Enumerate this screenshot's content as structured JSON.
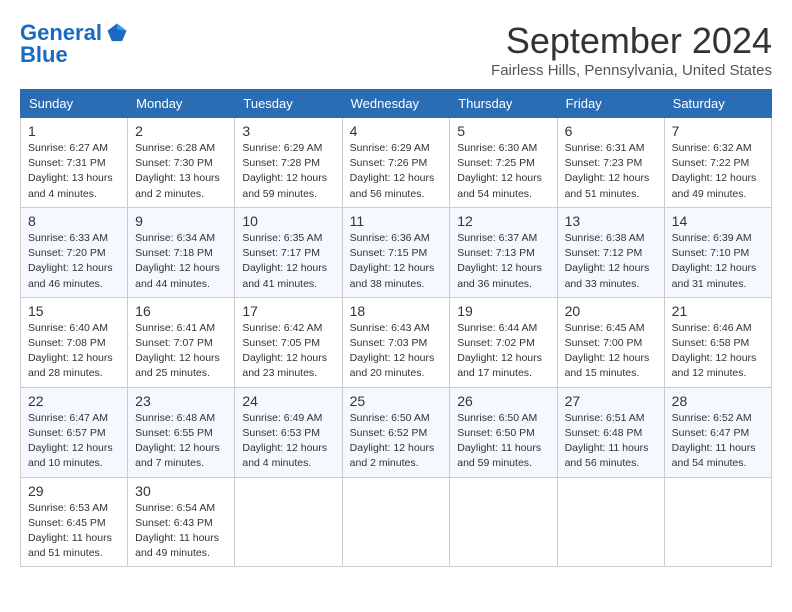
{
  "header": {
    "logo_general": "General",
    "logo_blue": "Blue",
    "month_year": "September 2024",
    "location": "Fairless Hills, Pennsylvania, United States"
  },
  "days_of_week": [
    "Sunday",
    "Monday",
    "Tuesday",
    "Wednesday",
    "Thursday",
    "Friday",
    "Saturday"
  ],
  "weeks": [
    [
      {
        "day": "1",
        "sunrise": "6:27 AM",
        "sunset": "7:31 PM",
        "daylight": "13 hours and 4 minutes."
      },
      {
        "day": "2",
        "sunrise": "6:28 AM",
        "sunset": "7:30 PM",
        "daylight": "13 hours and 2 minutes."
      },
      {
        "day": "3",
        "sunrise": "6:29 AM",
        "sunset": "7:28 PM",
        "daylight": "12 hours and 59 minutes."
      },
      {
        "day": "4",
        "sunrise": "6:29 AM",
        "sunset": "7:26 PM",
        "daylight": "12 hours and 56 minutes."
      },
      {
        "day": "5",
        "sunrise": "6:30 AM",
        "sunset": "7:25 PM",
        "daylight": "12 hours and 54 minutes."
      },
      {
        "day": "6",
        "sunrise": "6:31 AM",
        "sunset": "7:23 PM",
        "daylight": "12 hours and 51 minutes."
      },
      {
        "day": "7",
        "sunrise": "6:32 AM",
        "sunset": "7:22 PM",
        "daylight": "12 hours and 49 minutes."
      }
    ],
    [
      {
        "day": "8",
        "sunrise": "6:33 AM",
        "sunset": "7:20 PM",
        "daylight": "12 hours and 46 minutes."
      },
      {
        "day": "9",
        "sunrise": "6:34 AM",
        "sunset": "7:18 PM",
        "daylight": "12 hours and 44 minutes."
      },
      {
        "day": "10",
        "sunrise": "6:35 AM",
        "sunset": "7:17 PM",
        "daylight": "12 hours and 41 minutes."
      },
      {
        "day": "11",
        "sunrise": "6:36 AM",
        "sunset": "7:15 PM",
        "daylight": "12 hours and 38 minutes."
      },
      {
        "day": "12",
        "sunrise": "6:37 AM",
        "sunset": "7:13 PM",
        "daylight": "12 hours and 36 minutes."
      },
      {
        "day": "13",
        "sunrise": "6:38 AM",
        "sunset": "7:12 PM",
        "daylight": "12 hours and 33 minutes."
      },
      {
        "day": "14",
        "sunrise": "6:39 AM",
        "sunset": "7:10 PM",
        "daylight": "12 hours and 31 minutes."
      }
    ],
    [
      {
        "day": "15",
        "sunrise": "6:40 AM",
        "sunset": "7:08 PM",
        "daylight": "12 hours and 28 minutes."
      },
      {
        "day": "16",
        "sunrise": "6:41 AM",
        "sunset": "7:07 PM",
        "daylight": "12 hours and 25 minutes."
      },
      {
        "day": "17",
        "sunrise": "6:42 AM",
        "sunset": "7:05 PM",
        "daylight": "12 hours and 23 minutes."
      },
      {
        "day": "18",
        "sunrise": "6:43 AM",
        "sunset": "7:03 PM",
        "daylight": "12 hours and 20 minutes."
      },
      {
        "day": "19",
        "sunrise": "6:44 AM",
        "sunset": "7:02 PM",
        "daylight": "12 hours and 17 minutes."
      },
      {
        "day": "20",
        "sunrise": "6:45 AM",
        "sunset": "7:00 PM",
        "daylight": "12 hours and 15 minutes."
      },
      {
        "day": "21",
        "sunrise": "6:46 AM",
        "sunset": "6:58 PM",
        "daylight": "12 hours and 12 minutes."
      }
    ],
    [
      {
        "day": "22",
        "sunrise": "6:47 AM",
        "sunset": "6:57 PM",
        "daylight": "12 hours and 10 minutes."
      },
      {
        "day": "23",
        "sunrise": "6:48 AM",
        "sunset": "6:55 PM",
        "daylight": "12 hours and 7 minutes."
      },
      {
        "day": "24",
        "sunrise": "6:49 AM",
        "sunset": "6:53 PM",
        "daylight": "12 hours and 4 minutes."
      },
      {
        "day": "25",
        "sunrise": "6:50 AM",
        "sunset": "6:52 PM",
        "daylight": "12 hours and 2 minutes."
      },
      {
        "day": "26",
        "sunrise": "6:50 AM",
        "sunset": "6:50 PM",
        "daylight": "11 hours and 59 minutes."
      },
      {
        "day": "27",
        "sunrise": "6:51 AM",
        "sunset": "6:48 PM",
        "daylight": "11 hours and 56 minutes."
      },
      {
        "day": "28",
        "sunrise": "6:52 AM",
        "sunset": "6:47 PM",
        "daylight": "11 hours and 54 minutes."
      }
    ],
    [
      {
        "day": "29",
        "sunrise": "6:53 AM",
        "sunset": "6:45 PM",
        "daylight": "11 hours and 51 minutes."
      },
      {
        "day": "30",
        "sunrise": "6:54 AM",
        "sunset": "6:43 PM",
        "daylight": "11 hours and 49 minutes."
      },
      null,
      null,
      null,
      null,
      null
    ]
  ]
}
